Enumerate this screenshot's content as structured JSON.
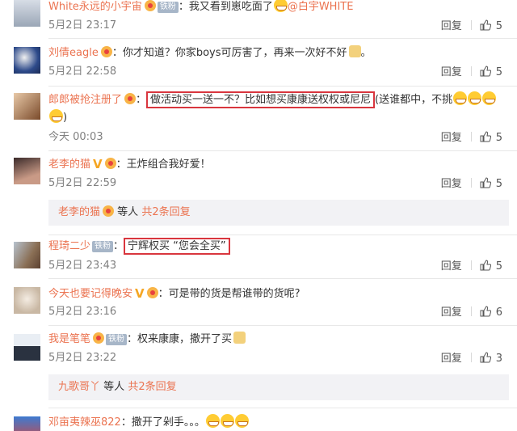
{
  "comments": [
    {
      "user": "White永远的小宇宙",
      "badges": [
        "crown",
        "fan"
      ],
      "fan_label": "铁粉",
      "text": "：我又看到崽吃面了",
      "text_after": "@白宇WHITE",
      "time": "5月2日 23:17",
      "reply": "回复",
      "likes": "5"
    },
    {
      "user": "刘倩eagle",
      "badges": [
        "crown"
      ],
      "text": "：你才知道？你家boys可厉害了，再来一次好不好",
      "time": "5月2日 22:58",
      "reply": "回复",
      "likes": "5"
    },
    {
      "user": "郎郎被抢注册了",
      "badges": [
        "crown"
      ],
      "text": "：",
      "highlight": "做活动买一送一不？比如想买康康送权权或尼尼",
      "text_after": "(送谁都中，不挑",
      "text_wrap": ")",
      "time": "今天 00:03",
      "reply": "回复",
      "likes": "5"
    },
    {
      "user": "老李的猫",
      "badges": [
        "v",
        "crown"
      ],
      "text": "：王炸组合我好爱！",
      "time": "5月2日 22:59",
      "reply": "回复",
      "likes": "5",
      "subreply": {
        "name": "老李的猫",
        "mid": "等人",
        "more": "共2条回复"
      }
    },
    {
      "user": "程琦二少",
      "badges": [
        "fan"
      ],
      "fan_label": "铁粉",
      "text": "：",
      "highlight": "宁辉权买 “您会全买”",
      "time": "5月2日 23:43",
      "reply": "回复",
      "likes": "5"
    },
    {
      "user": "今天也要记得晚安",
      "badges": [
        "v",
        "crown"
      ],
      "text": "：可是带的货是帮谁带的货呢?",
      "time": "5月2日 23:16",
      "reply": "回复",
      "likes": "6"
    },
    {
      "user": "我是笔笔",
      "badges": [
        "crown",
        "fan"
      ],
      "fan_label": "铁粉",
      "text": "：权来康康，撒开了买",
      "time": "5月2日 23:22",
      "reply": "回复",
      "likes": "3",
      "subreply": {
        "name": "九歌哥丫",
        "mid": "等人",
        "more": "共2条回复"
      }
    },
    {
      "user": "邓亩夷辣巫822",
      "badges": [],
      "text": "：撒开了剁手。。。",
      "time": "",
      "reply": "",
      "likes": ""
    }
  ],
  "colors": {
    "username": "#eb7350",
    "highlight_border": "#d9363e",
    "subreply_bg": "#f2f2f5"
  }
}
